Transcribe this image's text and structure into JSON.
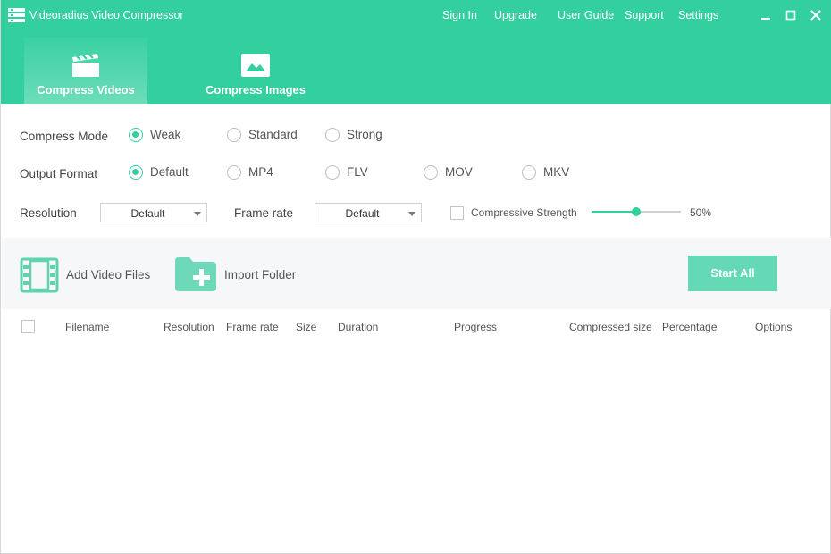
{
  "app": {
    "title": "Videoradius Video Compressor"
  },
  "nav": {
    "sign_in": "Sign In",
    "upgrade": "Upgrade",
    "user_guide": "User Guide",
    "support": "Support",
    "settings": "Settings"
  },
  "tabs": [
    {
      "label": "Compress Videos",
      "active": true
    },
    {
      "label": "Compress Images",
      "active": false
    }
  ],
  "compress_mode": {
    "label": "Compress Mode",
    "options": [
      "Weak",
      "Standard",
      "Strong"
    ],
    "selected": "Weak"
  },
  "output_format": {
    "label": "Output Format",
    "options": [
      "Default",
      "MP4",
      "FLV",
      "MOV",
      "MKV"
    ],
    "selected": "Default"
  },
  "resolution": {
    "label": "Resolution",
    "value": "Default"
  },
  "frame_rate": {
    "label": "Frame rate",
    "value": "Default"
  },
  "strength": {
    "label": "Compressive Strength",
    "checked": false,
    "value": 50,
    "display": "50%"
  },
  "toolbar": {
    "add_video_files": "Add Video Files",
    "import_folder": "Import Folder",
    "start_all": "Start All"
  },
  "table": {
    "columns": [
      "Filename",
      "Resolution",
      "Frame rate",
      "Size",
      "Duration",
      "Progress",
      "Compressed size",
      "Percentage",
      "Options"
    ],
    "rows": []
  },
  "colors": {
    "accent": "#33cf9e",
    "start_button": "#65d8b5",
    "toolbar_bg": "#f6f7f8"
  }
}
